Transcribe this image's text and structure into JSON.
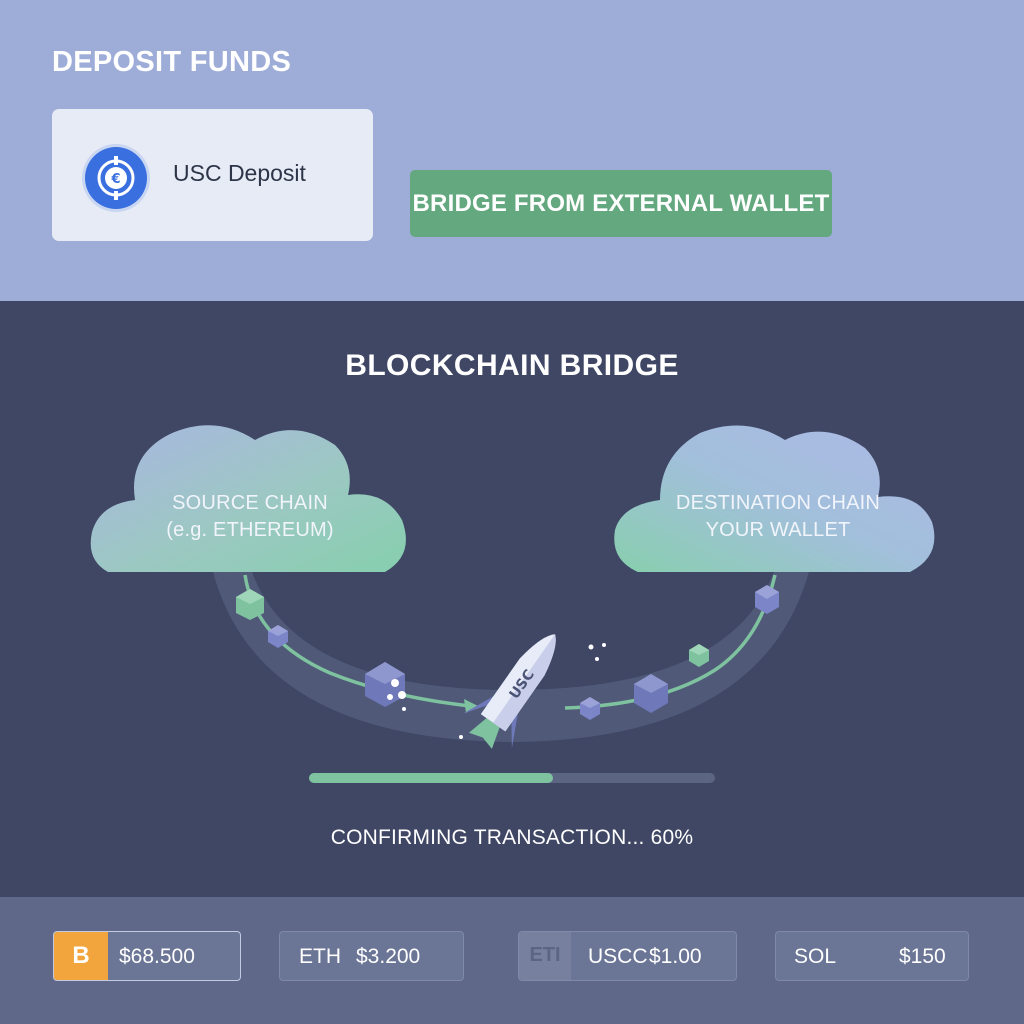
{
  "header": {
    "title": "DEPOSIT FUNDS",
    "deposit_option_label": "USC Deposit",
    "coin_icon": "euro-coin-icon",
    "bridge_button_label": "BRIDGE FROM EXTERNAL WALLET"
  },
  "bridge": {
    "title": "BLOCKCHAIN BRIDGE",
    "source": {
      "line1": "SOURCE CHAIN",
      "line2": "(e.g. ETHEREUM)"
    },
    "destination": {
      "line1": "DESTINATION CHAIN",
      "line2": "YOUR WALLET"
    },
    "rocket_label": "USC",
    "progress_percent": 60,
    "status_text": "CONFIRMING TRANSACTION...  60%"
  },
  "ticker": {
    "btc": {
      "icon": "bitcoin-icon",
      "symbol": "B",
      "price": "$68.500"
    },
    "eth": {
      "label": "ETH",
      "price": "$3.200"
    },
    "usdc": {
      "icon": "usdc-icon",
      "symbol": "ETI",
      "label": "USCC",
      "price": "$1.00"
    },
    "sol": {
      "label": "SOL",
      "price": "$150"
    }
  },
  "colors": {
    "top_bg": "#9eadd7",
    "mid_bg": "#3f4765",
    "accent_green": "#63a87e",
    "progress_green": "#7fc2a0",
    "bitcoin_orange": "#f2a53c",
    "coin_blue": "#3a6fe0"
  }
}
